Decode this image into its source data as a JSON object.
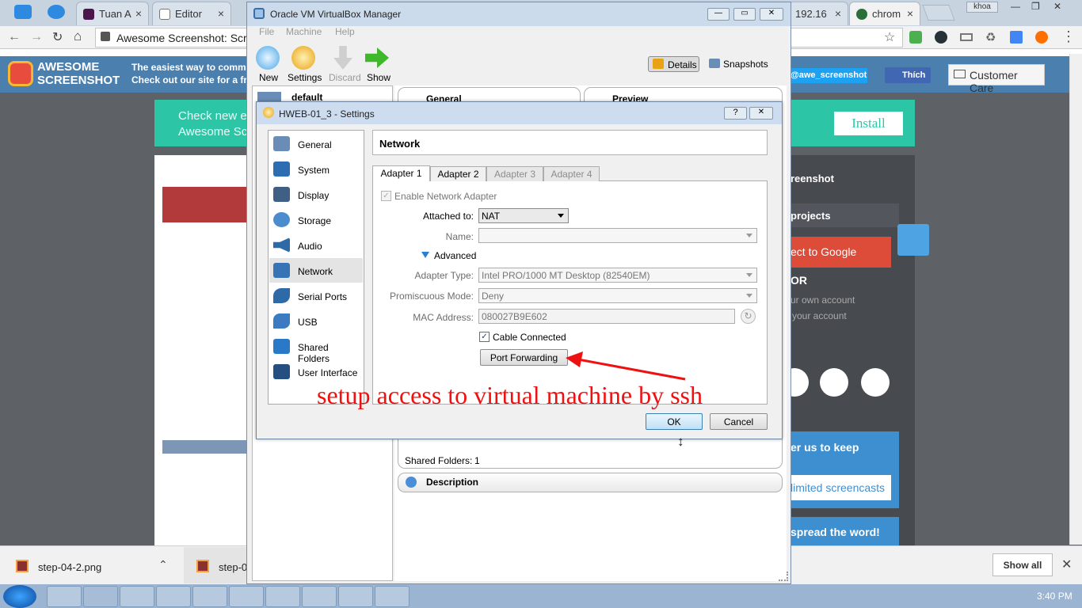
{
  "browser": {
    "tabs": [
      {
        "label": "Tuan A",
        "close": "×"
      },
      {
        "label": "Editor",
        "close": "×"
      },
      {
        "label": "192.16",
        "close": "×"
      },
      {
        "label": "chrom",
        "close": "×"
      }
    ],
    "url": "Awesome Screenshot: Scre",
    "profile": "khoa",
    "window_controls": [
      "—",
      "❐",
      "✕"
    ]
  },
  "awesome": {
    "brand_line1": "AWESOME",
    "brand_line2": "SCREENSHOT",
    "tagline1": "The easiest way to commu",
    "tagline2": "Check out our site for a free",
    "twitter": "@awe_screenshot",
    "like": "Thích",
    "care": "Customer Care",
    "banner1": "Check new e",
    "banner2": "Awesome Scr",
    "install": "Install",
    "panel_title": "reenshot",
    "projects": "projects",
    "google": "ect to Google",
    "or": "OR",
    "own1": "ur own account",
    "own2": "your account",
    "keep": "er us to keep",
    "unlimited": "limited screencasts",
    "spread": "spread the word!"
  },
  "downloads": {
    "file1": "step-04-2.png",
    "file2": "step-0",
    "show_all": "Show all"
  },
  "taskbar": {
    "time": "3:40 PM"
  },
  "vbox": {
    "title": "Oracle VM VirtualBox Manager",
    "menu": [
      "File",
      "Machine",
      "Help"
    ],
    "toolbar": [
      "New",
      "Settings",
      "Discard",
      "Show"
    ],
    "details": "Details",
    "snapshots": "Snapshots",
    "vm_name": "default",
    "general": "General",
    "preview": "Preview",
    "shared_folders_label": "Shared Folders:",
    "shared_folders_value": "1",
    "description": "Description"
  },
  "dialog": {
    "title": "HWEB-01_3 - Settings",
    "help": "?",
    "close": "✕",
    "categories": [
      "General",
      "System",
      "Display",
      "Storage",
      "Audio",
      "Network",
      "Serial Ports",
      "USB",
      "Shared Folders",
      "User Interface"
    ],
    "selected": "Network",
    "page_title": "Network",
    "adapter_tabs": [
      "Adapter 1",
      "Adapter 2",
      "Adapter 3",
      "Adapter 4"
    ],
    "enable_adapter": "Enable Network Adapter",
    "attached_label": "Attached to:",
    "attached_value": "NAT",
    "name_label": "Name:",
    "name_value": "",
    "advanced": "Advanced",
    "adapter_type_label": "Adapter Type:",
    "adapter_type_value": "Intel PRO/1000 MT Desktop (82540EM)",
    "promisc_label": "Promiscuous Mode:",
    "promisc_value": "Deny",
    "mac_label": "MAC Address:",
    "mac_value": "080027B9E602",
    "cable": "Cable Connected",
    "port_forwarding": "Port Forwarding",
    "ok": "OK",
    "cancel": "Cancel"
  },
  "annotation": {
    "text": "setup access to virtual machine by ssh",
    "color": "#ee1111"
  }
}
